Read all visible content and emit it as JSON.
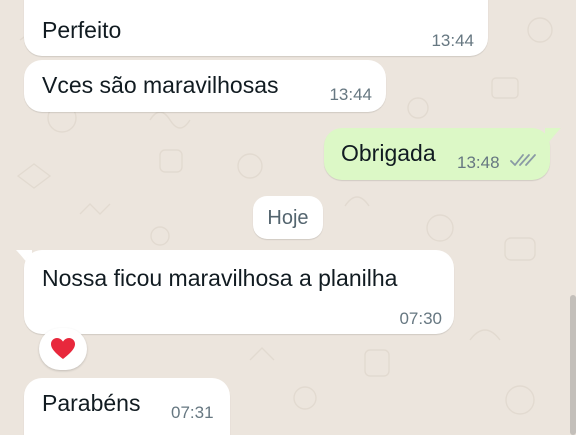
{
  "chat": {
    "messages": [
      {
        "text": "Perfeito",
        "time": "13:44",
        "direction": "incoming"
      },
      {
        "text": "Vces são maravilhosas",
        "time": "13:44",
        "direction": "incoming"
      },
      {
        "text": "Obrigada",
        "time": "13:48",
        "direction": "outgoing",
        "read_receipt": "double-check-icon"
      },
      {
        "text": "Nossa ficou maravilhosa a planilha",
        "time": "07:30",
        "direction": "incoming",
        "reaction": "heart-icon"
      },
      {
        "text": "Parabéns",
        "time": "07:31",
        "direction": "incoming"
      }
    ],
    "date_divider": "Hoje"
  },
  "colors": {
    "incoming_bubble": "#ffffff",
    "outgoing_bubble": "#dcf8c6",
    "timestamp": "#667781",
    "read_tick": "#8a9aa5",
    "heart": "#e8283c",
    "wallpaper": "#ece5dd"
  }
}
